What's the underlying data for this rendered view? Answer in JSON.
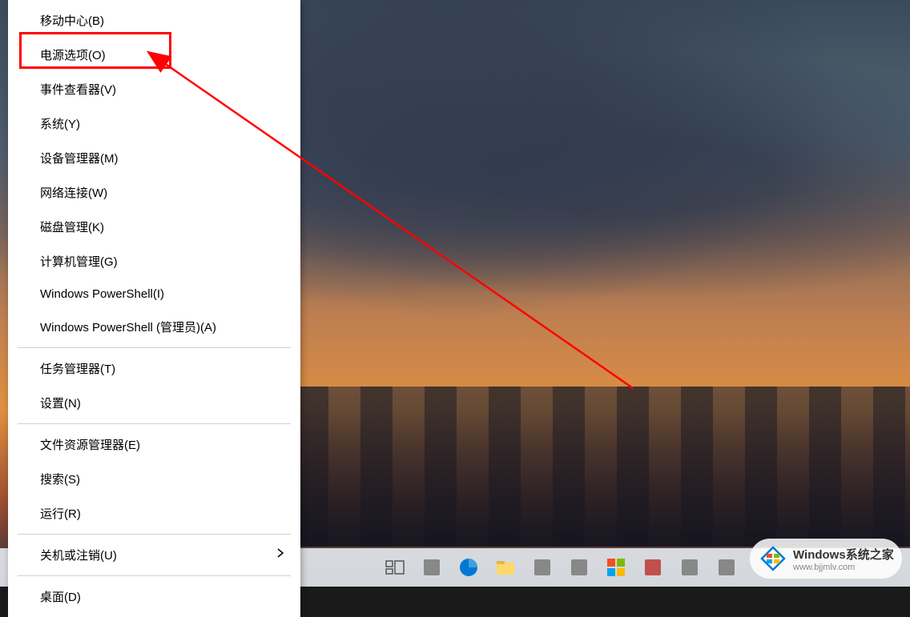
{
  "menu": {
    "items": [
      {
        "label": "移动中心(B)",
        "has_submenu": false
      },
      {
        "label": "电源选项(O)",
        "has_submenu": false,
        "highlighted": true
      },
      {
        "label": "事件查看器(V)",
        "has_submenu": false
      },
      {
        "label": "系统(Y)",
        "has_submenu": false
      },
      {
        "label": "设备管理器(M)",
        "has_submenu": false
      },
      {
        "label": "网络连接(W)",
        "has_submenu": false
      },
      {
        "label": "磁盘管理(K)",
        "has_submenu": false
      },
      {
        "label": "计算机管理(G)",
        "has_submenu": false
      },
      {
        "label": "Windows PowerShell(I)",
        "has_submenu": false
      },
      {
        "label": "Windows PowerShell (管理员)(A)",
        "has_submenu": false
      }
    ],
    "items2": [
      {
        "label": "任务管理器(T)",
        "has_submenu": false
      },
      {
        "label": "设置(N)",
        "has_submenu": false
      }
    ],
    "items3": [
      {
        "label": "文件资源管理器(E)",
        "has_submenu": false
      },
      {
        "label": "搜索(S)",
        "has_submenu": false
      },
      {
        "label": "运行(R)",
        "has_submenu": false
      }
    ],
    "items4": [
      {
        "label": "关机或注销(U)",
        "has_submenu": true
      }
    ],
    "items5": [
      {
        "label": "桌面(D)",
        "has_submenu": false
      }
    ]
  },
  "watermark": {
    "title": "Windows系统之家",
    "url": "www.bjjmlv.com"
  },
  "annotation": {
    "highlight_target": "电源选项(O)",
    "arrow_color": "#ff0000"
  }
}
